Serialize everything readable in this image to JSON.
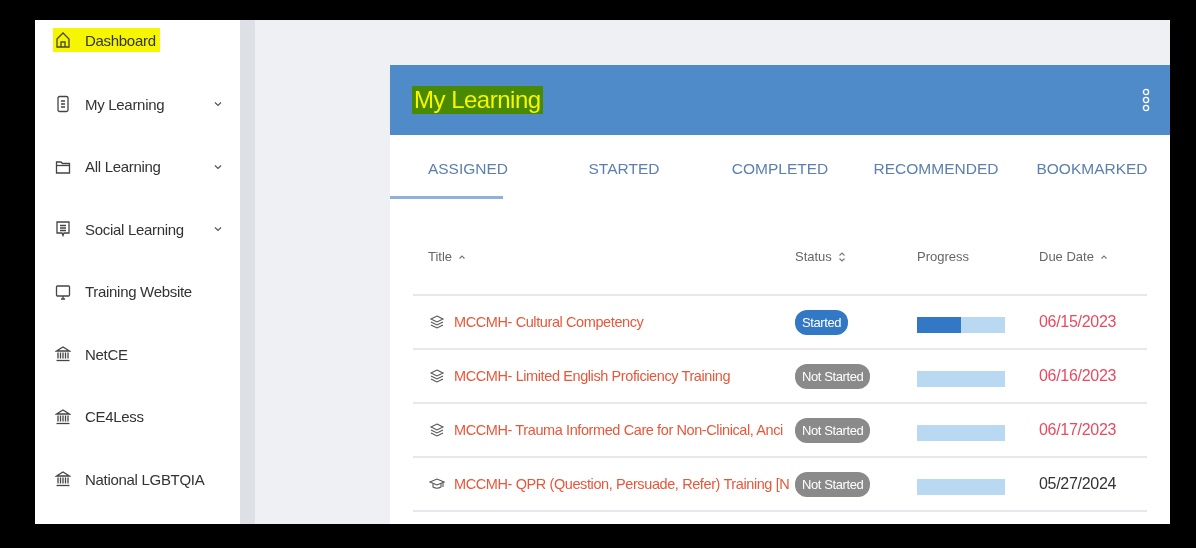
{
  "sidebar": {
    "items": [
      {
        "label": "Dashboard",
        "highlighted": true,
        "expandable": false
      },
      {
        "label": "My Learning",
        "highlighted": false,
        "expandable": true
      },
      {
        "label": "All Learning",
        "highlighted": false,
        "expandable": true
      },
      {
        "label": "Social Learning",
        "highlighted": false,
        "expandable": true
      },
      {
        "label": "Training Website",
        "highlighted": false,
        "expandable": false
      },
      {
        "label": "NetCE",
        "highlighted": false,
        "expandable": false
      },
      {
        "label": "CE4Less",
        "highlighted": false,
        "expandable": false
      },
      {
        "label": "National LGBTQIA",
        "highlighted": false,
        "expandable": false
      }
    ]
  },
  "card": {
    "title": "My Learning",
    "title_highlighted": true,
    "tabs": [
      {
        "label": "ASSIGNED",
        "selected": true
      },
      {
        "label": "STARTED",
        "selected": false
      },
      {
        "label": "COMPLETED",
        "selected": false
      },
      {
        "label": "RECOMMENDED",
        "selected": false
      },
      {
        "label": "BOOKMARKED",
        "selected": false
      }
    ],
    "table": {
      "columns": [
        {
          "label": "Title",
          "sortable": true,
          "sorted": true
        },
        {
          "label": "Status",
          "sortable": true,
          "sorted": false
        },
        {
          "label": "Progress",
          "sortable": false
        },
        {
          "label": "Due Date",
          "sortable": true,
          "sorted": true
        }
      ],
      "rows": [
        {
          "kind": "course",
          "title": "MCCMH- Cultural Competency",
          "status": "Started",
          "started": true,
          "level": 0.5,
          "due": "06/15/2023",
          "overdue": true
        },
        {
          "kind": "course",
          "title": "MCCMH- Limited English Proficiency Training",
          "status": "Not Started",
          "started": false,
          "due": "06/16/2023",
          "overdue": true
        },
        {
          "kind": "course",
          "title": "MCCMH- Trauma Informed Care for Non-Clinical, Anci",
          "status": "Not Started",
          "started": false,
          "due": "06/17/2023",
          "overdue": true
        },
        {
          "kind": "training",
          "title": "MCCMH- QPR (Question, Persuade, Refer) Training [N",
          "status": "Not Started",
          "started": false,
          "due": "05/27/2024",
          "overdue": false
        }
      ]
    }
  }
}
